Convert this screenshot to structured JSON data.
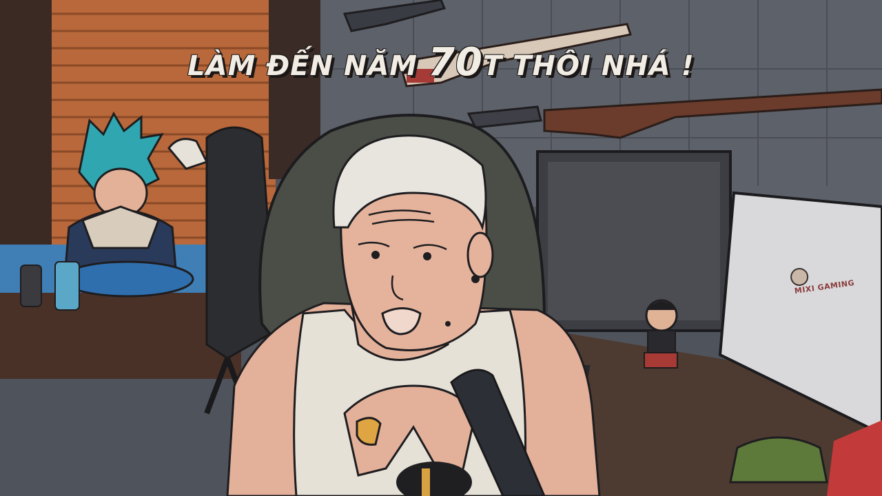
{
  "caption": {
    "part1": "LÀM ĐẾN NĂM ",
    "part2": "70",
    "part3": "T THÔI NHÁ !"
  },
  "monitor_logo": {
    "text": "MIXI GAMING"
  },
  "colors": {
    "caption_fill": "#f2ede4",
    "caption_outline": "#1b1716",
    "wall": "#5a5e67",
    "blinds": "#b8683a",
    "shirt": "#e6e1d6",
    "skin": "#e5b39c",
    "hair": "#e8e4de"
  }
}
